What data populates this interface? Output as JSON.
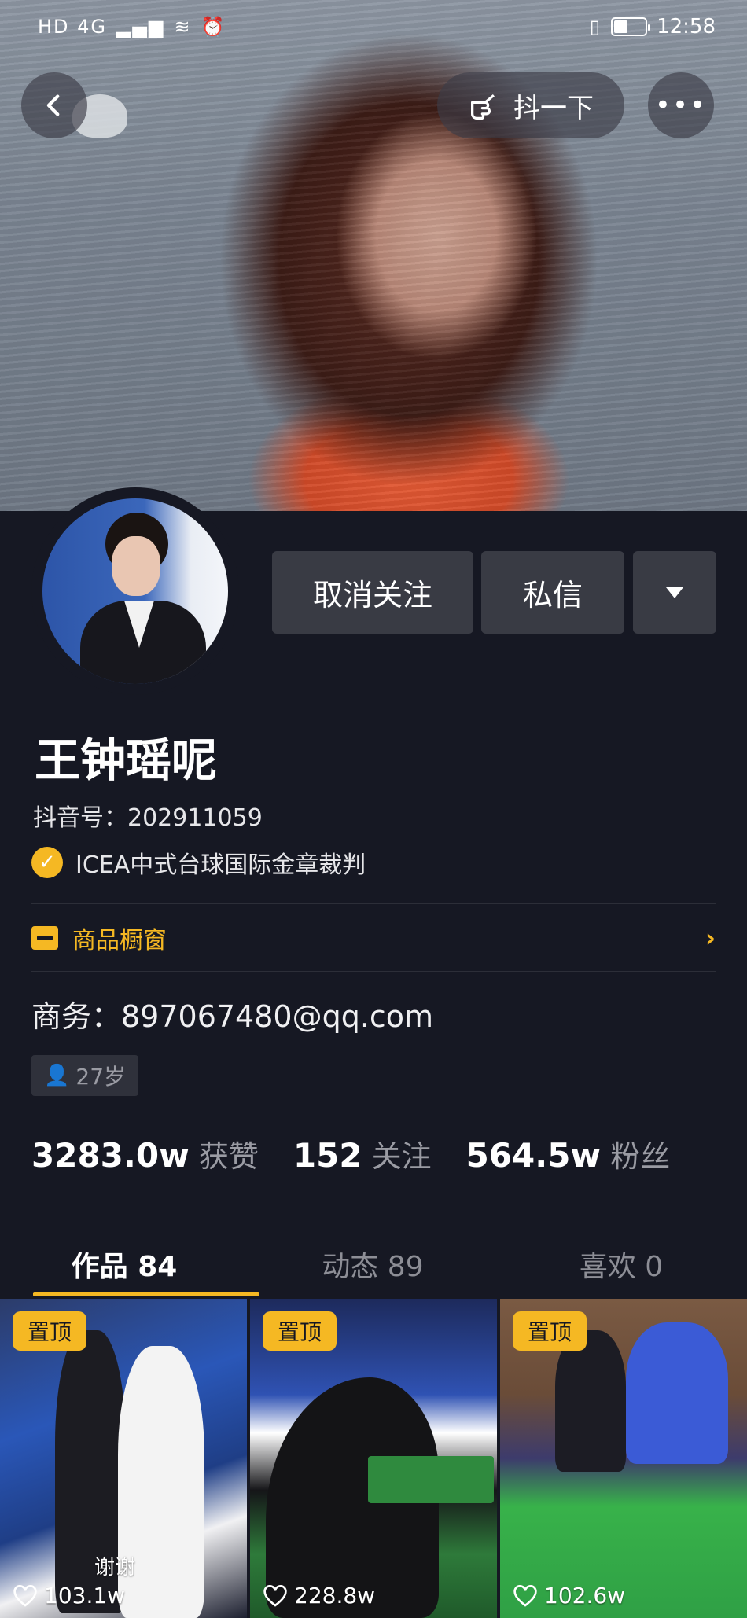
{
  "status_bar": {
    "network": "HD 4G",
    "time": "12:58",
    "battery_level": 0.45
  },
  "top_bar": {
    "shake_label": "抖一下"
  },
  "profile": {
    "unfollow_label": "取消关注",
    "message_label": "私信",
    "name": "王钟瑶呢",
    "douyin_id": "抖音号：202911059",
    "verification": "ICEA中式台球国际金章裁判",
    "shop_label": "商品橱窗",
    "business": "商务：897067480@qq.com",
    "age": "27岁"
  },
  "stats": [
    {
      "value": "3283.0w",
      "label": "获赞"
    },
    {
      "value": "152",
      "label": "关注"
    },
    {
      "value": "564.5w",
      "label": "粉丝"
    }
  ],
  "tabs": [
    {
      "label": "作品 84",
      "active": true
    },
    {
      "label": "动态 89",
      "active": false
    },
    {
      "label": "喜欢 0",
      "active": false
    }
  ],
  "videos": [
    {
      "pinned": "置顶",
      "likes": "103.1w",
      "caption": "谢谢"
    },
    {
      "pinned": "置顶",
      "likes": "228.8w",
      "caption": ""
    },
    {
      "pinned": "置顶",
      "likes": "102.6w",
      "caption": ""
    }
  ],
  "colors": {
    "background": "#161823",
    "accent": "#f5b823",
    "button": "#393b44"
  }
}
